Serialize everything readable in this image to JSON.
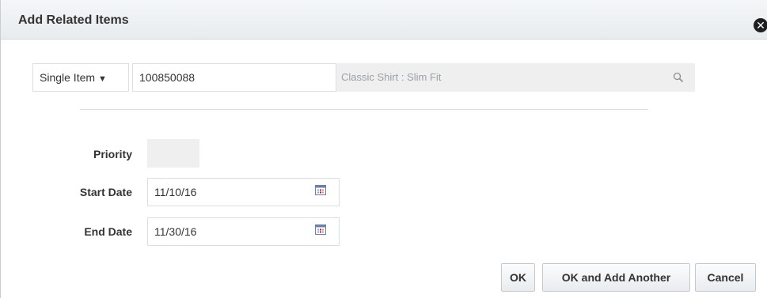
{
  "dialog": {
    "title": "Add Related Items",
    "close_icon": "close-icon"
  },
  "item_row": {
    "type_selected": "Single Item",
    "type_caret": "▼",
    "item_value": "100850088",
    "description": "Classic Shirt : Slim Fit",
    "search_icon": "search-icon"
  },
  "form": {
    "priority_label": "Priority",
    "priority_value": "",
    "start_date_label": "Start Date",
    "start_date_value": "11/10/16",
    "end_date_label": "End Date",
    "end_date_value": "11/30/16",
    "calendar_icon": "calendar-icon"
  },
  "buttons": {
    "ok": "OK",
    "ok_and_add_another": "OK and Add Another",
    "cancel": "Cancel"
  },
  "colors": {
    "title_bar": "#eceff2",
    "field_readonly": "#efefef",
    "calendar_red": "#c8102e"
  }
}
